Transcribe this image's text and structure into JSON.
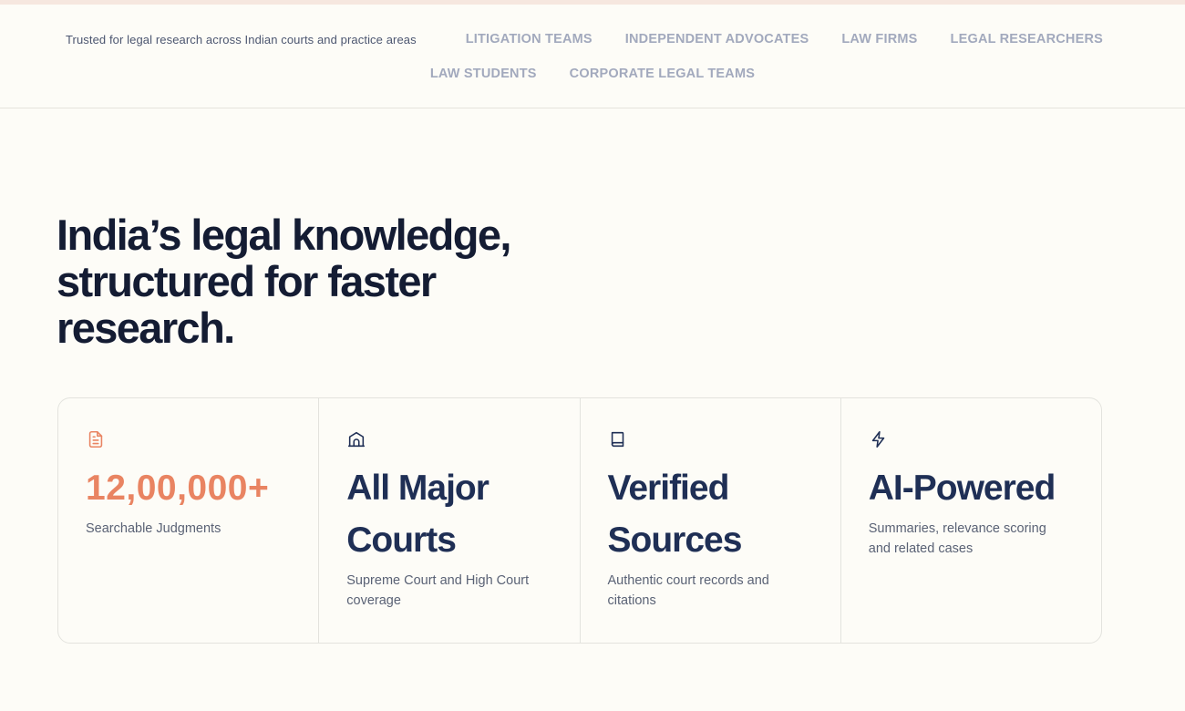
{
  "audience": {
    "trusted_text": "Trusted for legal research across Indian courts and practice areas",
    "tags_row1": [
      "LITIGATION TEAMS",
      "INDEPENDENT ADVOCATES",
      "LAW FIRMS",
      "LEGAL RESEARCHERS"
    ],
    "tags_row2": [
      "LAW STUDENTS",
      "CORPORATE LEGAL TEAMS"
    ]
  },
  "hero": {
    "title_line1": "India’s legal knowledge,",
    "title_line2": "structured for faster",
    "title_line3": "research."
  },
  "stats": [
    {
      "icon": "document-icon",
      "value": "12,00,000+",
      "description": "Searchable Judgments",
      "accent": "#e98462"
    },
    {
      "icon": "courthouse-icon",
      "value_line1": "All Major",
      "value_line2": "Courts",
      "description": "Supreme Court and High Court coverage"
    },
    {
      "icon": "book-icon",
      "value_line1": "Verified",
      "value_line2": "Sources",
      "description": "Authentic court records and citations"
    },
    {
      "icon": "lightning-icon",
      "value": "AI-Powered",
      "description": "Summaries, relevance scoring and related cases"
    }
  ],
  "colors": {
    "background": "#fdfcf7",
    "heading": "#141c33",
    "stat_value": "#1f2f55",
    "accent": "#e98462",
    "tag": "#a2a9bd"
  }
}
